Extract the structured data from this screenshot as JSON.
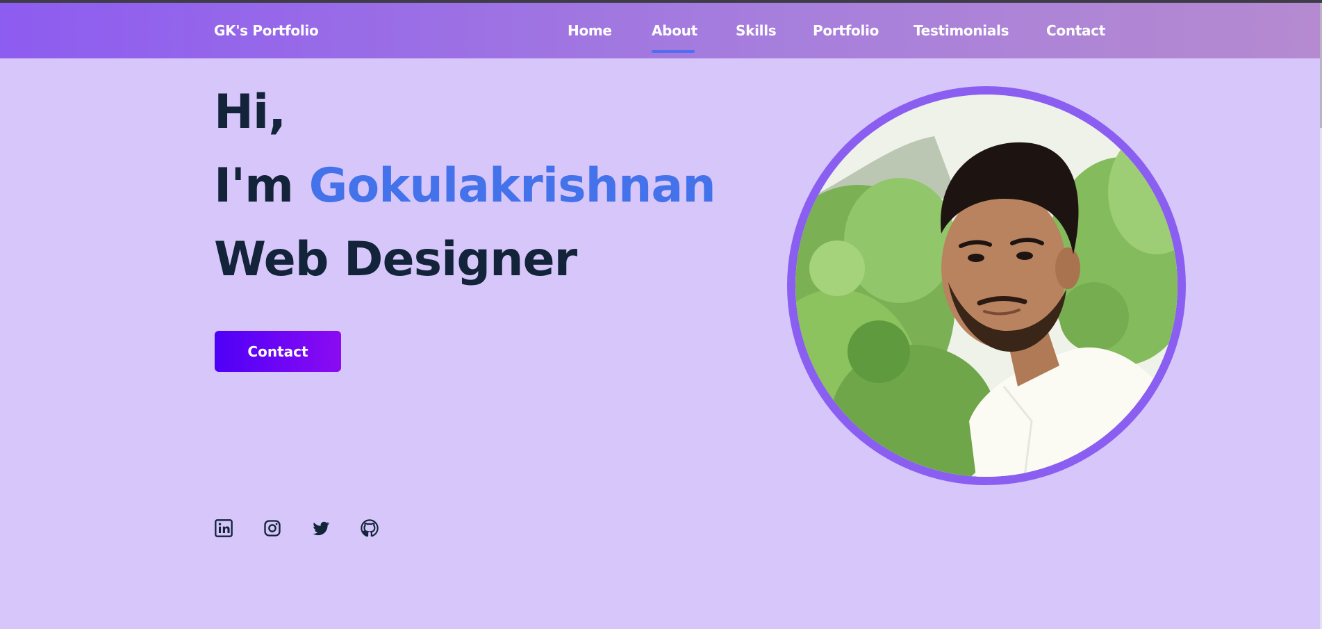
{
  "header": {
    "brand": "GK's Portfolio",
    "nav": [
      {
        "label": "Home"
      },
      {
        "label": "About",
        "active": true
      },
      {
        "label": "Skills"
      },
      {
        "label": "Portfolio"
      },
      {
        "label": "Testimonials"
      },
      {
        "label": "Contact"
      }
    ]
  },
  "hero": {
    "greeting": "Hi,",
    "intro_prefix": "I'm",
    "name": "Gokulakrishnan",
    "role": "Web Designer",
    "cta_label": "Contact"
  },
  "socials": [
    {
      "icon": "linkedin-icon"
    },
    {
      "icon": "instagram-icon"
    },
    {
      "icon": "twitter-icon"
    },
    {
      "icon": "github-icon"
    }
  ],
  "profile_photo": {
    "alt": "profile-photo"
  },
  "colors": {
    "background": "#d6c6f9",
    "header_start": "#8d5cf0",
    "header_end": "#b58ad0",
    "heading": "#12233a",
    "accent_name": "#4472ea",
    "button_start": "#4e00f7",
    "button_end": "#8b0bf2",
    "photo_ring": "#8a5ef0",
    "nav_underline": "#4f6ff0"
  }
}
